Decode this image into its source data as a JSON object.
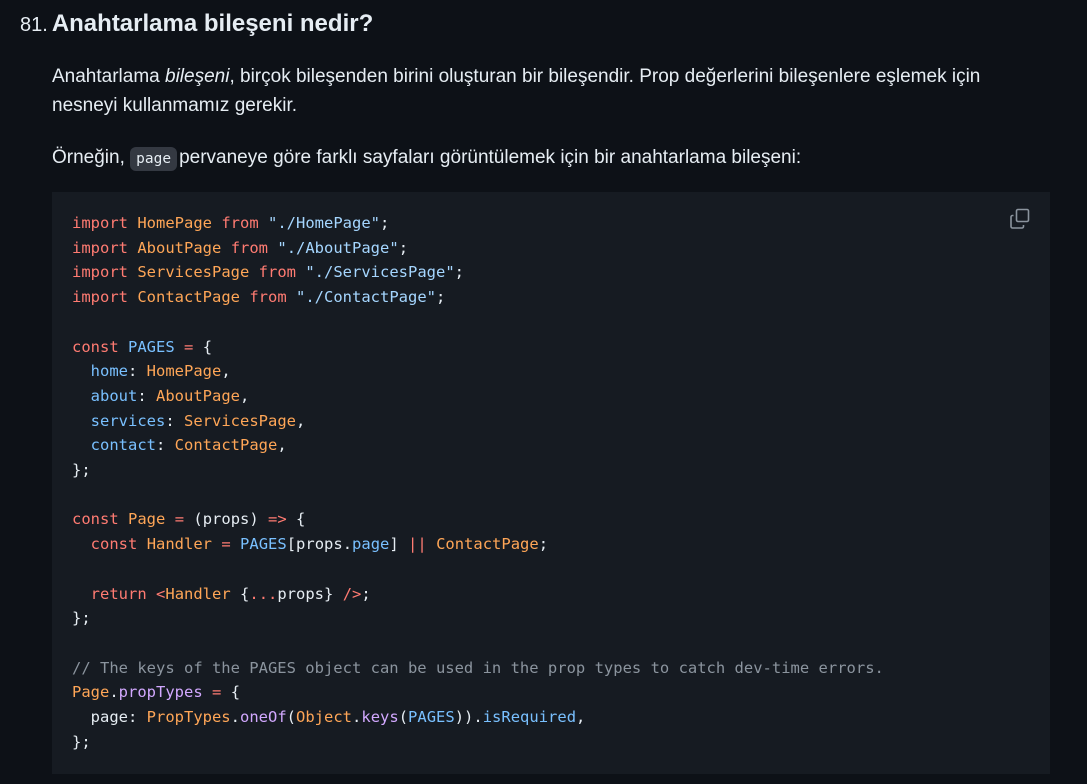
{
  "question": {
    "number": "81.",
    "title": "Anahtarlama bileşeni nedir?"
  },
  "paragraph1": {
    "before": "Anahtarlama ",
    "emphasis": "bileşeni",
    "after": ", birçok bileşenden birini oluşturan bir bileşendir. Prop değerlerini bileşenlere eşlemek için nesneyi kullanmamız gerekir."
  },
  "paragraph2": {
    "before": "Örneğin, ",
    "inline_code": "page",
    "after": "pervaneye göre farklı sayfaları görüntülemek için bir anahtarlama bileşeni:"
  },
  "code_block": {
    "copy_icon": "copy-icon",
    "lines": [
      [
        {
          "t": "k",
          "v": "import"
        },
        {
          "t": "p",
          "v": " "
        },
        {
          "t": "i",
          "v": "HomePage"
        },
        {
          "t": "p",
          "v": " "
        },
        {
          "t": "k",
          "v": "from"
        },
        {
          "t": "p",
          "v": " "
        },
        {
          "t": "s",
          "v": "\"./HomePage\""
        },
        {
          "t": "p",
          "v": ";"
        }
      ],
      [
        {
          "t": "k",
          "v": "import"
        },
        {
          "t": "p",
          "v": " "
        },
        {
          "t": "i",
          "v": "AboutPage"
        },
        {
          "t": "p",
          "v": " "
        },
        {
          "t": "k",
          "v": "from"
        },
        {
          "t": "p",
          "v": " "
        },
        {
          "t": "s",
          "v": "\"./AboutPage\""
        },
        {
          "t": "p",
          "v": ";"
        }
      ],
      [
        {
          "t": "k",
          "v": "import"
        },
        {
          "t": "p",
          "v": " "
        },
        {
          "t": "i",
          "v": "ServicesPage"
        },
        {
          "t": "p",
          "v": " "
        },
        {
          "t": "k",
          "v": "from"
        },
        {
          "t": "p",
          "v": " "
        },
        {
          "t": "s",
          "v": "\"./ServicesPage\""
        },
        {
          "t": "p",
          "v": ";"
        }
      ],
      [
        {
          "t": "k",
          "v": "import"
        },
        {
          "t": "p",
          "v": " "
        },
        {
          "t": "i",
          "v": "ContactPage"
        },
        {
          "t": "p",
          "v": " "
        },
        {
          "t": "k",
          "v": "from"
        },
        {
          "t": "p",
          "v": " "
        },
        {
          "t": "s",
          "v": "\"./ContactPage\""
        },
        {
          "t": "p",
          "v": ";"
        }
      ],
      [],
      [
        {
          "t": "k",
          "v": "const"
        },
        {
          "t": "p",
          "v": " "
        },
        {
          "t": "o",
          "v": "PAGES"
        },
        {
          "t": "p",
          "v": " "
        },
        {
          "t": "k",
          "v": "="
        },
        {
          "t": "p",
          "v": " {"
        }
      ],
      [
        {
          "t": "p",
          "v": "  "
        },
        {
          "t": "o",
          "v": "home"
        },
        {
          "t": "p",
          "v": ": "
        },
        {
          "t": "i",
          "v": "HomePage"
        },
        {
          "t": "p",
          "v": ","
        }
      ],
      [
        {
          "t": "p",
          "v": "  "
        },
        {
          "t": "o",
          "v": "about"
        },
        {
          "t": "p",
          "v": ": "
        },
        {
          "t": "i",
          "v": "AboutPage"
        },
        {
          "t": "p",
          "v": ","
        }
      ],
      [
        {
          "t": "p",
          "v": "  "
        },
        {
          "t": "o",
          "v": "services"
        },
        {
          "t": "p",
          "v": ": "
        },
        {
          "t": "i",
          "v": "ServicesPage"
        },
        {
          "t": "p",
          "v": ","
        }
      ],
      [
        {
          "t": "p",
          "v": "  "
        },
        {
          "t": "o",
          "v": "contact"
        },
        {
          "t": "p",
          "v": ": "
        },
        {
          "t": "i",
          "v": "ContactPage"
        },
        {
          "t": "p",
          "v": ","
        }
      ],
      [
        {
          "t": "p",
          "v": "};"
        }
      ],
      [],
      [
        {
          "t": "k",
          "v": "const"
        },
        {
          "t": "p",
          "v": " "
        },
        {
          "t": "i",
          "v": "Page"
        },
        {
          "t": "p",
          "v": " "
        },
        {
          "t": "k",
          "v": "="
        },
        {
          "t": "p",
          "v": " (props) "
        },
        {
          "t": "k",
          "v": "=>"
        },
        {
          "t": "p",
          "v": " {"
        }
      ],
      [
        {
          "t": "p",
          "v": "  "
        },
        {
          "t": "k",
          "v": "const"
        },
        {
          "t": "p",
          "v": " "
        },
        {
          "t": "i",
          "v": "Handler"
        },
        {
          "t": "p",
          "v": " "
        },
        {
          "t": "k",
          "v": "="
        },
        {
          "t": "p",
          "v": " "
        },
        {
          "t": "o",
          "v": "PAGES"
        },
        {
          "t": "p",
          "v": "[props."
        },
        {
          "t": "o",
          "v": "page"
        },
        {
          "t": "p",
          "v": "] "
        },
        {
          "t": "k",
          "v": "||"
        },
        {
          "t": "p",
          "v": " "
        },
        {
          "t": "i",
          "v": "ContactPage"
        },
        {
          "t": "p",
          "v": ";"
        }
      ],
      [],
      [
        {
          "t": "p",
          "v": "  "
        },
        {
          "t": "k",
          "v": "return"
        },
        {
          "t": "p",
          "v": " "
        },
        {
          "t": "k",
          "v": "<"
        },
        {
          "t": "i",
          "v": "Handler"
        },
        {
          "t": "p",
          "v": " {"
        },
        {
          "t": "k",
          "v": "..."
        },
        {
          "t": "p",
          "v": "props} "
        },
        {
          "t": "k",
          "v": "/>"
        },
        {
          "t": "p",
          "v": ";"
        }
      ],
      [
        {
          "t": "p",
          "v": "};"
        }
      ],
      [],
      [
        {
          "t": "c",
          "v": "// The keys of the PAGES object can be used in the prop types to catch dev-time errors."
        }
      ],
      [
        {
          "t": "i",
          "v": "Page"
        },
        {
          "t": "p",
          "v": "."
        },
        {
          "t": "f",
          "v": "propTypes"
        },
        {
          "t": "p",
          "v": " "
        },
        {
          "t": "k",
          "v": "="
        },
        {
          "t": "p",
          "v": " {"
        }
      ],
      [
        {
          "t": "p",
          "v": "  page: "
        },
        {
          "t": "i",
          "v": "PropTypes"
        },
        {
          "t": "p",
          "v": "."
        },
        {
          "t": "f",
          "v": "oneOf"
        },
        {
          "t": "p",
          "v": "("
        },
        {
          "t": "i",
          "v": "Object"
        },
        {
          "t": "p",
          "v": "."
        },
        {
          "t": "f",
          "v": "keys"
        },
        {
          "t": "p",
          "v": "("
        },
        {
          "t": "o",
          "v": "PAGES"
        },
        {
          "t": "p",
          "v": "))."
        },
        {
          "t": "o",
          "v": "isRequired"
        },
        {
          "t": "p",
          "v": ","
        }
      ],
      [
        {
          "t": "p",
          "v": "};"
        }
      ]
    ]
  }
}
